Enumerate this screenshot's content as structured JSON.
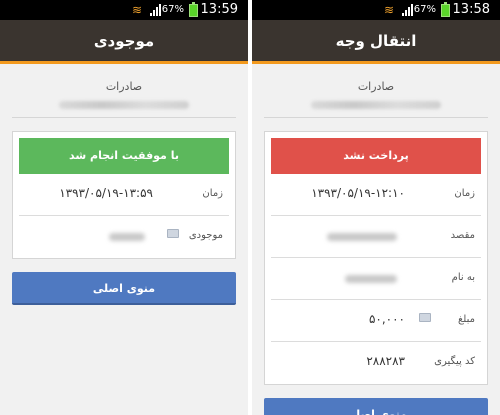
{
  "left": {
    "status": {
      "time": "13:59",
      "battery": "67%"
    },
    "title": "موجودی",
    "section_label": "صادرات",
    "banner": "با موفقیت انجام شد",
    "rows": [
      {
        "label": "زمان",
        "value": "۱۳۹۳/۰۵/۱۹-۱۳:۵۹"
      },
      {
        "label": "موجودی"
      }
    ],
    "button": "منوی اصلی"
  },
  "right": {
    "status": {
      "time": "13:58",
      "battery": "67%"
    },
    "title": "انتقال وجه",
    "section_label": "صادرات",
    "banner": "پرداخت نشد",
    "rows": [
      {
        "label": "زمان",
        "value": "۱۳۹۳/۰۵/۱۹-۱۲:۱۰"
      },
      {
        "label": "مقصد"
      },
      {
        "label": "به نام"
      },
      {
        "label": "مبلغ",
        "value": "۵۰,۰۰۰"
      },
      {
        "label": "کد پیگیری",
        "value": "۲۸۸۲۸۳"
      }
    ],
    "button": "منوی اصلی"
  },
  "colors": {
    "titlebar": "#3a342f",
    "accent": "#f39a1e",
    "success": "#5cb85c",
    "fail": "#e0514a",
    "button": "#4f79c1"
  },
  "icons": [
    "wifi-icon",
    "signal-icon",
    "battery-icon",
    "currency-icon"
  ]
}
